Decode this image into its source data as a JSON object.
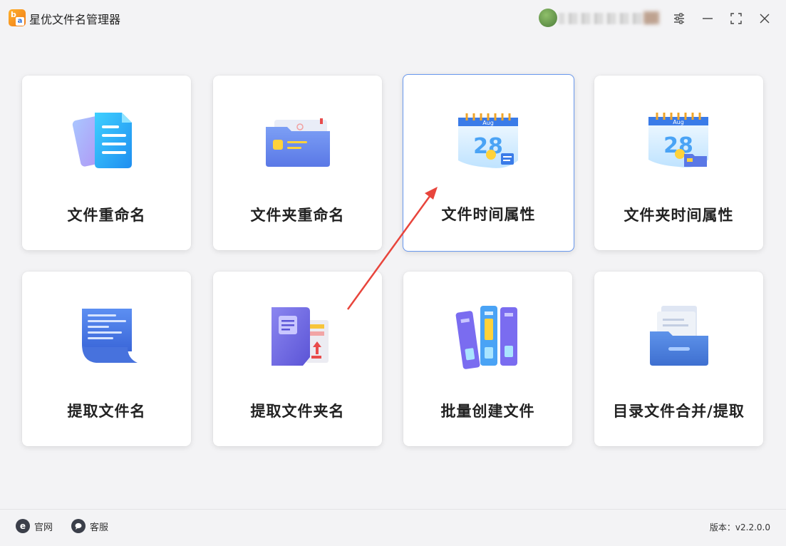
{
  "app": {
    "title": "星优文件名管理器"
  },
  "window_controls": [
    "settings-icon",
    "minimize-icon",
    "maximize-icon",
    "close-icon"
  ],
  "cards": [
    {
      "id": "file-rename",
      "label": "文件重命名",
      "icon": "documents-icon"
    },
    {
      "id": "folder-rename",
      "label": "文件夹重命名",
      "icon": "folder-icon"
    },
    {
      "id": "file-time",
      "label": "文件时间属性",
      "icon": "calendar-icon",
      "active": true
    },
    {
      "id": "folder-time",
      "label": "文件夹时间属性",
      "icon": "calendar-folder-icon"
    },
    {
      "id": "extract-filename",
      "label": "提取文件名",
      "icon": "scroll-icon"
    },
    {
      "id": "extract-foldername",
      "label": "提取文件夹名",
      "icon": "book-export-icon"
    },
    {
      "id": "batch-create",
      "label": "批量创建文件",
      "icon": "binders-icon"
    },
    {
      "id": "dir-merge",
      "label": "目录文件合并/提取",
      "icon": "file-drawer-icon"
    }
  ],
  "calendar_text": {
    "month": "Aug",
    "day": "28"
  },
  "footer": {
    "website_label": "官网",
    "support_label": "客服",
    "version": "版本：v2.2.0.0"
  },
  "colors": {
    "accent_border": "#6b9af0",
    "arrow": "#e8453c",
    "background": "#f3f3f5"
  }
}
